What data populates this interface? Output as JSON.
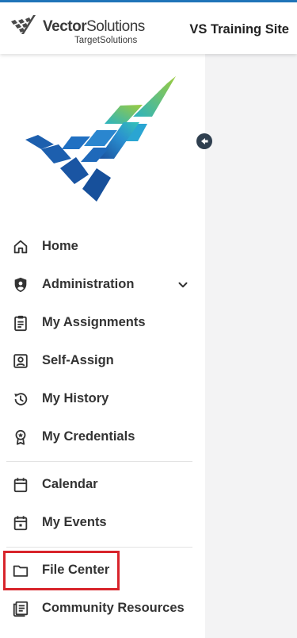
{
  "header": {
    "brand_bold": "Vector",
    "brand_light": "Solutions",
    "brand_sub": "TargetSolutions",
    "site_title": "VS Training Site"
  },
  "sidebar": {
    "items": [
      {
        "label": "Home",
        "icon": "home-icon"
      },
      {
        "label": "Administration",
        "icon": "shield-icon"
      },
      {
        "label": "My Assignments",
        "icon": "clipboard-icon"
      },
      {
        "label": "Self-Assign",
        "icon": "id-badge-icon"
      },
      {
        "label": "My History",
        "icon": "history-icon"
      },
      {
        "label": "My Credentials",
        "icon": "award-icon"
      },
      {
        "label": "Calendar",
        "icon": "calendar-icon"
      },
      {
        "label": "My Events",
        "icon": "event-icon"
      },
      {
        "label": "File Center",
        "icon": "folder-icon"
      },
      {
        "label": "Community Resources",
        "icon": "newspaper-icon"
      }
    ]
  },
  "colors": {
    "accent": "#1f74b8",
    "highlight": "#d8242b",
    "logo_blue": "#1d5fae",
    "logo_green": "#8cc63f"
  }
}
